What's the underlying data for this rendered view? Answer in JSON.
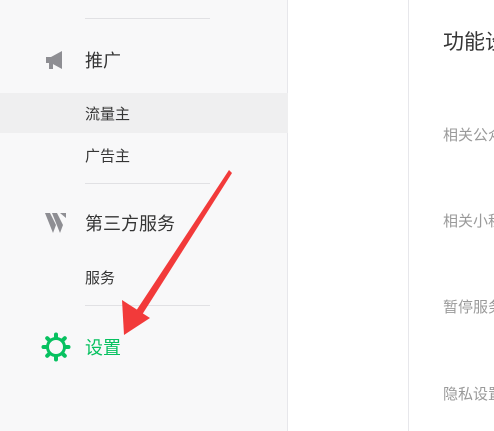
{
  "sidebar": {
    "groups": [
      {
        "label": "推广",
        "icon": "megaphone-icon",
        "items": [
          {
            "label": "流量主",
            "selected": true
          },
          {
            "label": "广告主",
            "selected": false
          }
        ]
      },
      {
        "label": "第三方服务",
        "icon": "third-party-logo-icon",
        "items": [
          {
            "label": "服务",
            "selected": false
          }
        ]
      },
      {
        "label": "设置",
        "icon": "gear-icon",
        "active": true,
        "items": []
      }
    ]
  },
  "content": {
    "title": "功能设",
    "rows": [
      {
        "label": "相关公众号"
      },
      {
        "label": "相关小程序"
      },
      {
        "label": "暂停服务设置"
      },
      {
        "label": "隐私设置"
      }
    ]
  },
  "colors": {
    "accent": "#07c160",
    "annotation": "#f23a3a",
    "sidebar_bg": "#f8f8f9",
    "selected_bg": "#efeff0",
    "text_primary": "#353535",
    "text_muted": "#9a9a9a",
    "icon_gray": "#8e8e93"
  }
}
